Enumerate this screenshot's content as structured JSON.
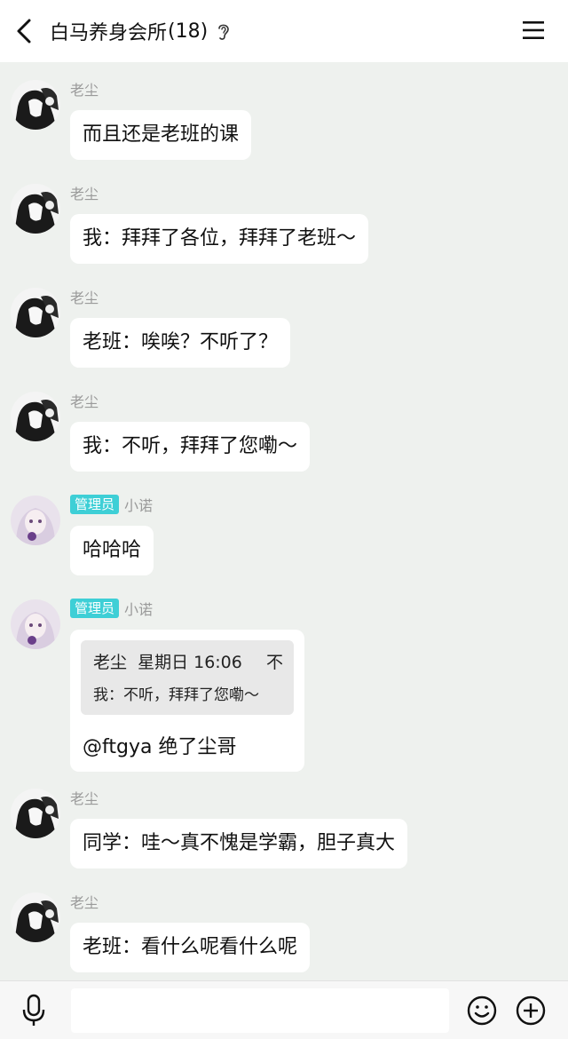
{
  "header": {
    "title": "白马养身会所",
    "member_count": "(18)"
  },
  "messages": [
    {
      "sender": "老尘",
      "avatar": "manga-avatar",
      "text": "而且还是老班的课"
    },
    {
      "sender": "老尘",
      "avatar": "manga-avatar",
      "text": "我：拜拜了各位，拜拜了老班～"
    },
    {
      "sender": "老尘",
      "avatar": "manga-avatar",
      "text": "老班：唉唉？不听了？"
    },
    {
      "sender": "老尘",
      "avatar": "manga-avatar",
      "text": "我：不听，拜拜了您嘞～"
    },
    {
      "badge": "管理员",
      "sender": "小诺",
      "avatar": "anime-avatar",
      "text": "哈哈哈"
    },
    {
      "badge": "管理员",
      "sender": "小诺",
      "avatar": "anime-avatar",
      "quote": {
        "author": "老尘",
        "time": "星期日 16:06",
        "text": "我：不听，拜拜了您嘞～",
        "trailing": "不"
      },
      "text": "@ftgya 绝了尘哥"
    },
    {
      "sender": "老尘",
      "avatar": "manga-avatar",
      "text": "同学：哇～真不愧是学霸，胆子真大"
    },
    {
      "sender": "老尘",
      "avatar": "manga-avatar",
      "text": "老班：看什么呢看什么呢"
    }
  ],
  "input": {
    "placeholder": ""
  },
  "colors": {
    "badge": "#3ecfd6",
    "chat_background": "#eef1ee"
  }
}
